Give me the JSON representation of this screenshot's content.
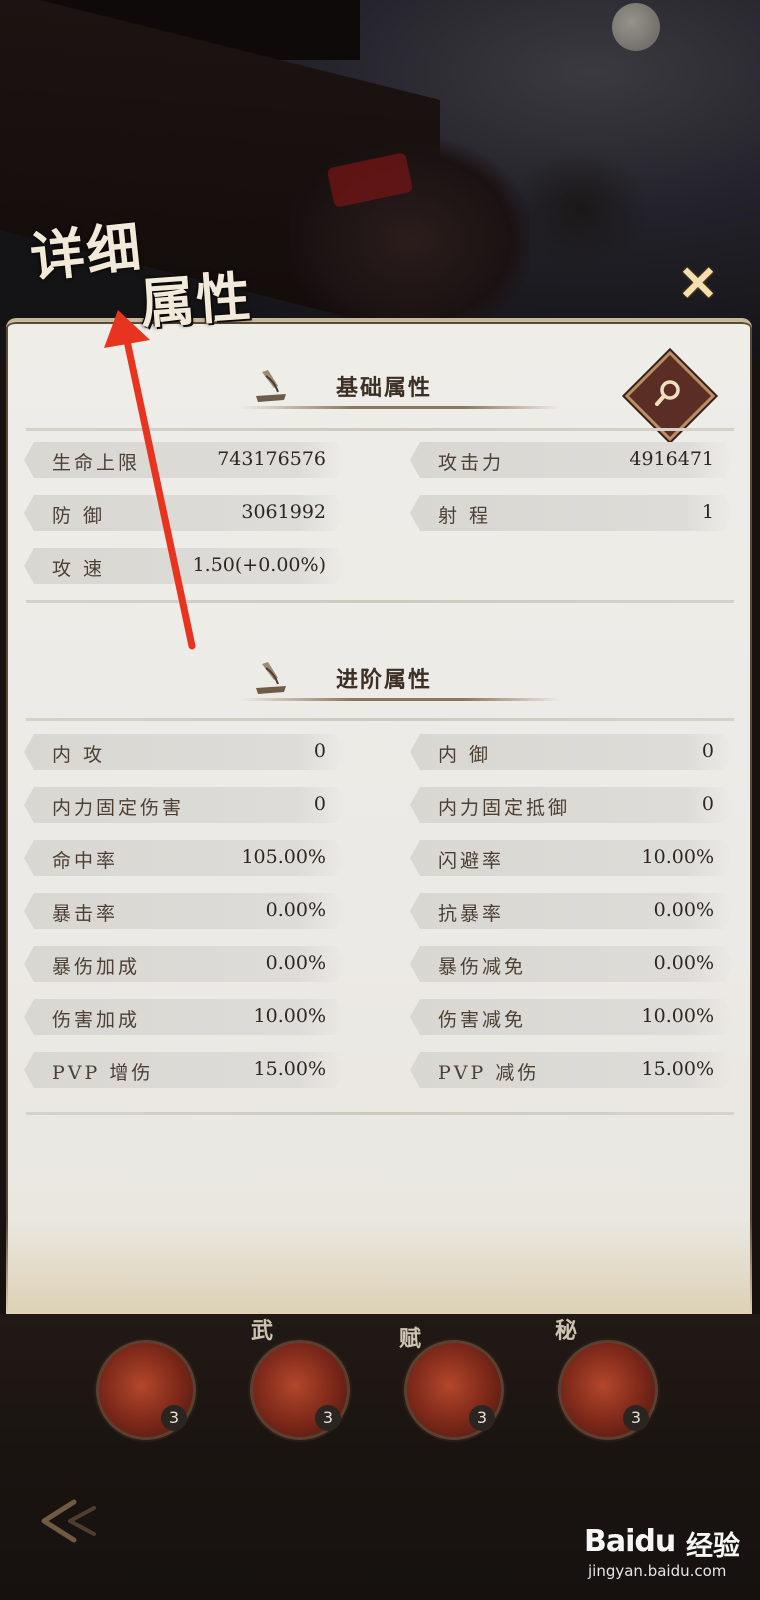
{
  "header": {
    "title_line1": "详细",
    "title_line2": "属性",
    "close_glyph": "✕"
  },
  "basic": {
    "title": "基础属性",
    "stats": [
      {
        "label": "生命上限",
        "value": "743176576"
      },
      {
        "label": "攻击力",
        "value": "4916471"
      },
      {
        "label": "防 御",
        "value": "3061992"
      },
      {
        "label": "射 程",
        "value": "1"
      },
      {
        "label": "攻 速",
        "value": "1.50(+0.00%)"
      }
    ]
  },
  "advanced": {
    "title": "进阶属性",
    "stats": [
      {
        "label": "内 攻",
        "value": "0"
      },
      {
        "label": "内 御",
        "value": "0"
      },
      {
        "label": "内力固定伤害",
        "value": "0"
      },
      {
        "label": "内力固定抵御",
        "value": "0"
      },
      {
        "label": "命中率",
        "value": "105.00%"
      },
      {
        "label": "闪避率",
        "value": "10.00%"
      },
      {
        "label": "暴击率",
        "value": "0.00%"
      },
      {
        "label": "抗暴率",
        "value": "0.00%"
      },
      {
        "label": "暴伤加成",
        "value": "0.00%"
      },
      {
        "label": "暴伤减免",
        "value": "0.00%"
      },
      {
        "label": "伤害加成",
        "value": "10.00%"
      },
      {
        "label": "伤害减免",
        "value": "10.00%"
      },
      {
        "label": "PVP 增伤",
        "value": "15.00%"
      },
      {
        "label": "PVP 减伤",
        "value": "15.00%"
      }
    ]
  },
  "skills": [
    {
      "glyph": "",
      "count": "3"
    },
    {
      "glyph": "武",
      "count": "3"
    },
    {
      "glyph": "赋",
      "count": "3"
    },
    {
      "glyph": "秘",
      "count": "3"
    }
  ],
  "icons": {
    "search": "search-icon",
    "close": "close-icon",
    "back": "back-arrow-icon"
  },
  "colors": {
    "annotation_arrow": "#e8331f",
    "panel_bg": "#eceae6",
    "stat_pill": "#dbd9d4"
  },
  "watermark": {
    "brand": "Baidu",
    "cn": "经验",
    "url": "jingyan.baidu.com"
  }
}
